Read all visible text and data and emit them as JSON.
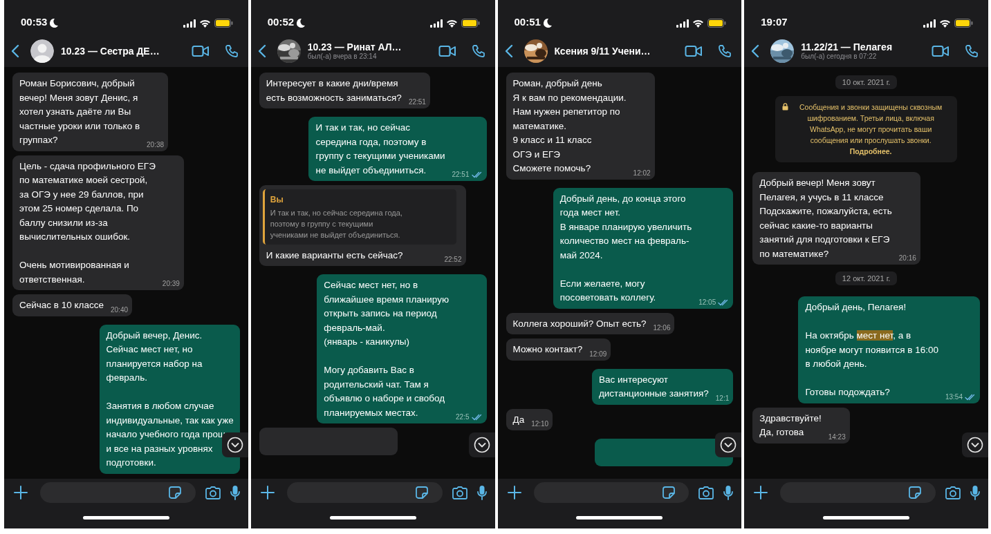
{
  "phones": [
    {
      "status": {
        "time": "00:53",
        "dnd": true
      },
      "header": {
        "title": "10.23 — Сестра ДЕ…",
        "avatar": {
          "kind": "silhouette"
        }
      },
      "messages": [
        {
          "kind": "in",
          "text": "Роман Борисович, добрый\nвечер! Меня зовут Денис, я\nхотел узнать даёте ли Вы\nчастные уроки или только в\nгруппах?",
          "time": "20:38"
        },
        {
          "kind": "in",
          "text": "Цель - сдача профильного ЕГЭ\nпо математике моей сестрой,\nза ОГЭ у нее 29 баллов, при\nэтом 25 номер сделала. По\nбаллу снизили из-за\nвычислительных ошибок.\n\nОчень мотивированная и\nответственная.",
          "time": "20:39"
        },
        {
          "kind": "in",
          "text": "Сейчас в 10 классе",
          "time": "20:40"
        },
        {
          "kind": "out",
          "text": "Добрый вечер, Денис.\nСейчас мест нет, но\nпланируется набор на\nфевраль.\n\nЗанятия в любом случае\nиндивидуальные, так как уже\nначало учебного года прош\nи все на разных уровнях\nподготовки."
        }
      ]
    },
    {
      "status": {
        "time": "00:52",
        "dnd": true
      },
      "header": {
        "title": "10.23 — Ринат АЛ…",
        "subtitle": "был(-а) вчера в 23:14"
      },
      "messages": [
        {
          "kind": "in",
          "text": "Интересует в какие дни/время\nесть возможность заниматься?",
          "time": "22:51"
        },
        {
          "kind": "out",
          "text": "И так и так, но сейчас\nсередина года, поэтому в\nгруппу с текущими учениками\nне выйдет объединиться.",
          "time": "22:51",
          "read": true
        },
        {
          "kind": "in",
          "quote": {
            "author": "Вы",
            "text": "И так и так, но сейчас середина года,\nпоэтому в группу с текущими\nучениками не выйдет объединиться."
          },
          "text": "И какие варианты есть сейчас?",
          "time": "22:52"
        },
        {
          "kind": "out",
          "text": "Сейчас мест нет, но в\nближайшее время планирую\nоткрыть запись на период\nфевраль-май.\n(январь - каникулы)\n\nМогу добавить Вас в\nродительский чат. Там я\nобъявлю о наборе и свобод\nпланируемых местах.",
          "time": "22:5",
          "read": true
        },
        {
          "kind": "in"
        }
      ]
    },
    {
      "status": {
        "time": "00:51",
        "dnd": true
      },
      "header": {
        "title": "Ксения 9/11 Учени…"
      },
      "messages": [
        {
          "kind": "in",
          "text": "Роман, добрый день\nЯ к вам по рекомендации.\nНам нужен репетитор по\nматематике.\n9 класс и 11 класс\nОГЭ и ЕГЭ\nСможете помочь?",
          "time": "12:02"
        },
        {
          "kind": "out",
          "text": "Добрый день, до конца этого\nгода мест нет.\nВ январе планирую увеличить\nколичество мест на февраль-\nмай 2024.\n\nЕсли желаете, могу\nпосоветовать коллегу.",
          "time": "12:05",
          "read": true
        },
        {
          "kind": "in",
          "text": "Коллега хороший? Опыт есть?",
          "time": "12:06"
        },
        {
          "kind": "in",
          "text": "Можно контакт?",
          "time": "12:09"
        },
        {
          "kind": "out",
          "text": "Вас интересуют\nдистанционные занятия?",
          "time": "12:1"
        },
        {
          "kind": "in",
          "text": "Да",
          "time": "12:10"
        },
        {
          "kind": "out"
        }
      ]
    },
    {
      "status": {
        "time": "19:07",
        "dnd": false
      },
      "header": {
        "title": "11.22/21 — Пелагея",
        "subtitle": "был(-а) сегодня в 07:22"
      },
      "messages": [
        {
          "kind": "date",
          "text": "10 окт. 2021 г."
        },
        {
          "kind": "system",
          "text": "Сообщения и звонки защищены сквозным шифрованием. Третьи лица, включая WhatsApp, не могут прочитать ваши сообщения или прослушать звонки. **Подробнее.**"
        },
        {
          "kind": "in",
          "text": "Добрый вечер! Меня зовут\nПелагея, я учусь в 11 классе\nПодскажите, пожалуйста, есть\nсейчас какие-то варианты\nзанятий для подготовки к ЕГЭ\nпо математике?",
          "time": "20:16"
        },
        {
          "kind": "date",
          "text": "12 окт. 2021 г."
        },
        {
          "kind": "out",
          "segments": [
            {
              "text": "Добрый день, Пелагея!\n\nНа октябрь ",
              "highlighted": false
            },
            {
              "text": "мест нет",
              "highlighted": true
            },
            {
              "text": ", а в\nноябре могут появится в 16:00\nв любой день.\n\nГотовы подождать?",
              "highlighted": false
            }
          ],
          "time": "13:54",
          "read": true
        },
        {
          "kind": "in",
          "text": "Здравствуйте!\nДа, готова",
          "time": "14:23"
        }
      ]
    }
  ]
}
